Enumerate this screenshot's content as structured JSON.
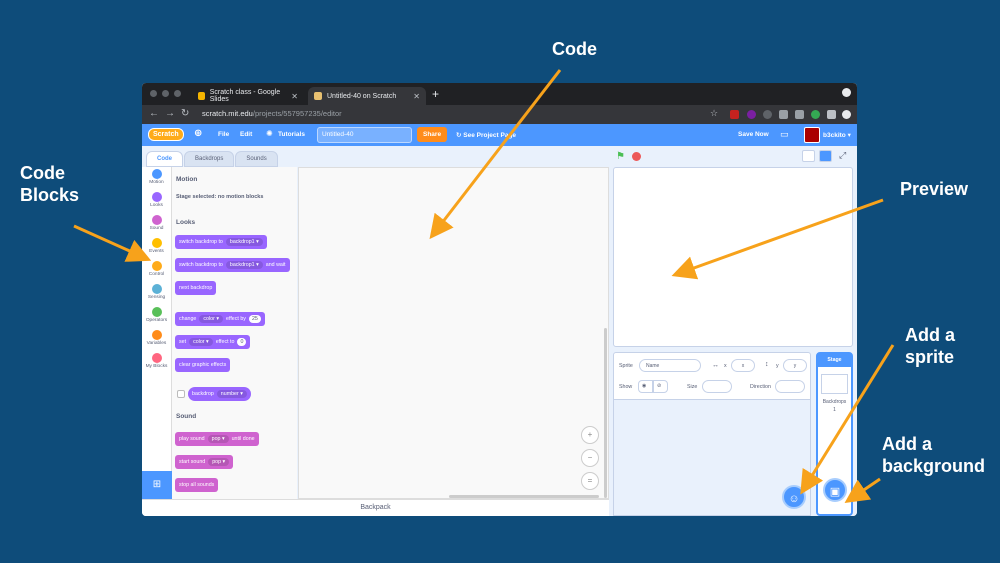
{
  "annotations": {
    "code": "Code",
    "code_blocks_1": "Code",
    "code_blocks_2": "Blocks",
    "preview": "Preview",
    "add_sprite_1": "Add a",
    "add_sprite_2": "sprite",
    "add_background_1": "Add a",
    "add_background_2": "background"
  },
  "browser": {
    "tabs": [
      {
        "label": "Scratch class - Google Slides",
        "icon_color": "#f4b400"
      },
      {
        "label": "Untitled-40 on Scratch",
        "icon_color": "#e8c070"
      }
    ],
    "close_glyph": "✕",
    "new_tab_glyph": "+",
    "url_host": "scratch.mit.edu",
    "url_path": "/projects/557957235/editor"
  },
  "menubar": {
    "logo": "Scratch",
    "file": "File",
    "edit": "Edit",
    "tutorials": "Tutorials",
    "project_title": "Untitled-40",
    "share": "Share",
    "see_project_page": "See Project Page",
    "save_now": "Save Now",
    "username": "b3ckito"
  },
  "editor_tabs": {
    "code": "Code",
    "backdrops": "Backdrops",
    "sounds": "Sounds"
  },
  "categories": [
    {
      "label": "Motion",
      "color": "#4c97ff"
    },
    {
      "label": "Looks",
      "color": "#9966ff"
    },
    {
      "label": "Sound",
      "color": "#cf63cf"
    },
    {
      "label": "Events",
      "color": "#ffbf00"
    },
    {
      "label": "Control",
      "color": "#ffab19"
    },
    {
      "label": "Sensing",
      "color": "#5cb1d6"
    },
    {
      "label": "Operators",
      "color": "#59c059"
    },
    {
      "label": "Variables",
      "color": "#ff8c1a"
    },
    {
      "label": "My Blocks",
      "color": "#ff6680"
    }
  ],
  "palette": {
    "motion_heading": "Motion",
    "motion_note": "Stage selected: no motion blocks",
    "looks_heading": "Looks",
    "switch_backdrop_to": "switch backdrop to",
    "backdrop1": "backdrop1",
    "and_wait": "and wait",
    "next_backdrop": "next backdrop",
    "change": "change",
    "color": "color",
    "effect_by": "effect by",
    "effect_by_value": "25",
    "set": "set",
    "effect_to": "effect to",
    "effect_to_value": "0",
    "clear_graphic_effects": "clear graphic effects",
    "backdrop": "backdrop",
    "number": "number",
    "sound_heading": "Sound",
    "play_sound": "play sound",
    "pop": "pop",
    "until_done": "until done",
    "start_sound": "start sound",
    "stop_all_sounds": "stop all sounds"
  },
  "backpack": "Backpack",
  "sprite_info": {
    "sprite": "Sprite",
    "name_placeholder": "Name",
    "x": "x",
    "y": "y",
    "show": "Show",
    "size": "Size",
    "direction": "Direction"
  },
  "stage_panel": {
    "title": "Stage",
    "backdrops": "Backdrops",
    "backdrops_count": "1"
  },
  "zoom": {
    "in": "+",
    "out": "−",
    "reset": "="
  }
}
